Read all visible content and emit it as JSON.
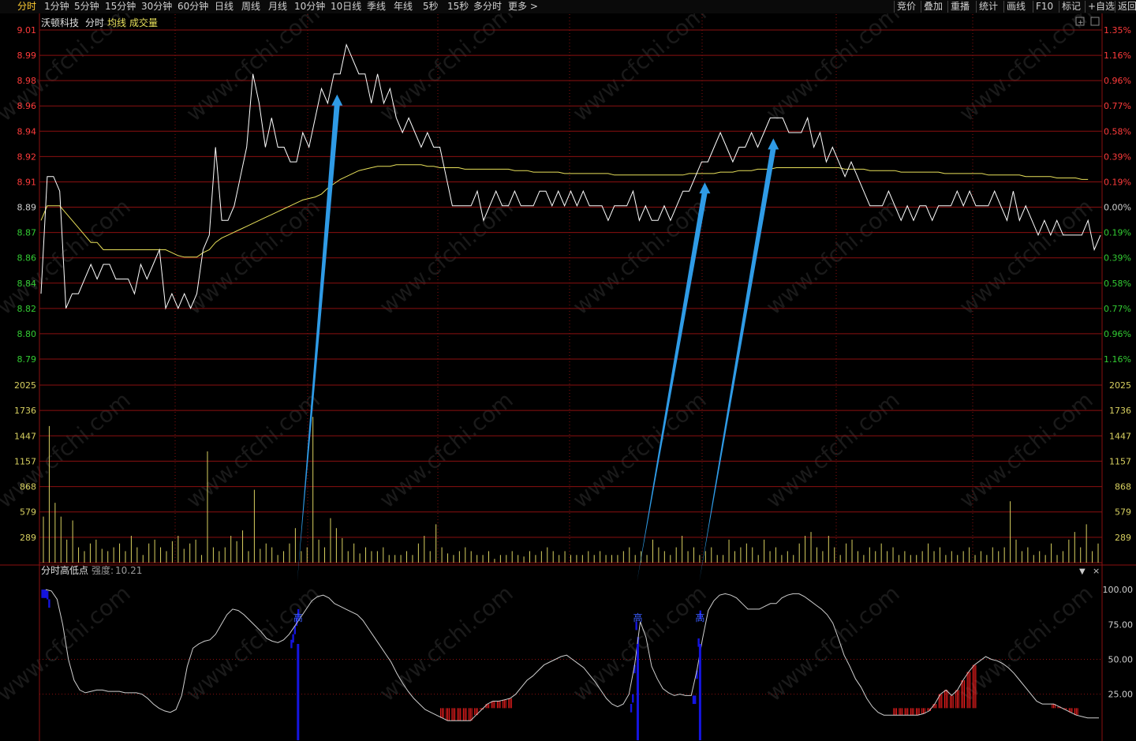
{
  "toolbar": {
    "left": [
      "分时",
      "1分钟",
      "5分钟",
      "15分钟",
      "30分钟",
      "60分钟",
      "日线",
      "周线",
      "月线",
      "10分钟",
      "10日线",
      "季线",
      "年线",
      "5秒",
      "15秒",
      "多分时",
      "更多 >"
    ],
    "active": "分时",
    "right": [
      "竞价",
      "叠加",
      "重播",
      "统计",
      "画线",
      "F10",
      "标记",
      "+自选",
      "返回"
    ]
  },
  "header": {
    "stock_name": "沃顿科技",
    "mode": "分时",
    "avg_label": "均线",
    "vol_label": "成交量"
  },
  "indicator": {
    "name": "分时高低点",
    "strength_label": "强度:",
    "strength_value": "10.21",
    "high_marker": "高"
  },
  "colors": {
    "price_line": "#ffffff",
    "avg_line": "#e8e05a",
    "up_label": "#ff3b3b",
    "down_label": "#33cc33",
    "volume": "#d8d060",
    "grid": "#8a1010",
    "arrow": "#2f9be6",
    "high_bar": "#1515e0",
    "low_bar": "#ff2020"
  },
  "chart_data": [
    {
      "type": "line",
      "title": "沃顿科技 分时",
      "price_ticks_left": [
        "9.01",
        "8.99",
        "8.98",
        "8.96",
        "8.94",
        "8.92",
        "8.91",
        "8.89",
        "8.87",
        "8.86",
        "8.84",
        "8.82",
        "8.80",
        "8.79"
      ],
      "pct_ticks_right": [
        "1.35%",
        "1.16%",
        "0.96%",
        "0.77%",
        "0.58%",
        "0.39%",
        "0.19%",
        "0.00%",
        "0.19%",
        "0.39%",
        "0.58%",
        "0.77%",
        "0.96%",
        "1.16%"
      ],
      "ylim": [
        8.78,
        9.01
      ],
      "prev_close": 8.89,
      "series": [
        {
          "name": "分时",
          "values": [
            8.83,
            8.91,
            8.91,
            8.9,
            8.82,
            8.83,
            8.83,
            8.84,
            8.85,
            8.84,
            8.85,
            8.85,
            8.84,
            8.84,
            8.84,
            8.83,
            8.85,
            8.84,
            8.85,
            8.86,
            8.82,
            8.83,
            8.82,
            8.83,
            8.82,
            8.83,
            8.86,
            8.87,
            8.93,
            8.88,
            8.88,
            8.89,
            8.91,
            8.93,
            8.98,
            8.96,
            8.93,
            8.95,
            8.93,
            8.93,
            8.92,
            8.92,
            8.94,
            8.93,
            8.95,
            8.97,
            8.96,
            8.98,
            8.98,
            9.0,
            8.99,
            8.98,
            8.98,
            8.96,
            8.98,
            8.96,
            8.97,
            8.95,
            8.94,
            8.95,
            8.94,
            8.93,
            8.94,
            8.93,
            8.93,
            8.91,
            8.89,
            8.89,
            8.89,
            8.89,
            8.9,
            8.88,
            8.89,
            8.9,
            8.89,
            8.89,
            8.9,
            8.89,
            8.89,
            8.89,
            8.9,
            8.9,
            8.89,
            8.9,
            8.89,
            8.9,
            8.89,
            8.9,
            8.89,
            8.89,
            8.89,
            8.88,
            8.89,
            8.89,
            8.89,
            8.9,
            8.88,
            8.89,
            8.88,
            8.88,
            8.89,
            8.88,
            8.89,
            8.9,
            8.9,
            8.91,
            8.92,
            8.92,
            8.93,
            8.94,
            8.93,
            8.92,
            8.93,
            8.93,
            8.94,
            8.93,
            8.94,
            8.95,
            8.95,
            8.95,
            8.94,
            8.94,
            8.94,
            8.95,
            8.93,
            8.94,
            8.92,
            8.93,
            8.92,
            8.91,
            8.92,
            8.91,
            8.9,
            8.89,
            8.89,
            8.89,
            8.9,
            8.89,
            8.88,
            8.89,
            8.88,
            8.89,
            8.89,
            8.88,
            8.89,
            8.89,
            8.89,
            8.9,
            8.89,
            8.9,
            8.89,
            8.89,
            8.89,
            8.9,
            8.89,
            8.88,
            8.9,
            8.88,
            8.89,
            8.88,
            8.87,
            8.88,
            8.87,
            8.88,
            8.87,
            8.87,
            8.87,
            8.87,
            8.88,
            8.86,
            8.87
          ]
        },
        {
          "name": "均线",
          "values": [
            8.88,
            8.89,
            8.89,
            8.89,
            8.885,
            8.88,
            8.875,
            8.87,
            8.865,
            8.865,
            8.86,
            8.86,
            8.86,
            8.86,
            8.86,
            8.86,
            8.86,
            8.86,
            8.86,
            8.86,
            8.86,
            8.858,
            8.856,
            8.855,
            8.855,
            8.855,
            8.858,
            8.86,
            8.865,
            8.868,
            8.87,
            8.872,
            8.874,
            8.876,
            8.878,
            8.88,
            8.882,
            8.884,
            8.886,
            8.888,
            8.89,
            8.892,
            8.894,
            8.895,
            8.896,
            8.898,
            8.902,
            8.905,
            8.908,
            8.91,
            8.912,
            8.914,
            8.915,
            8.916,
            8.917,
            8.917,
            8.917,
            8.918,
            8.918,
            8.918,
            8.918,
            8.918,
            8.917,
            8.917,
            8.916,
            8.916,
            8.916,
            8.916,
            8.915,
            8.915,
            8.915,
            8.915,
            8.915,
            8.915,
            8.915,
            8.915,
            8.914,
            8.914,
            8.914,
            8.913,
            8.913,
            8.913,
            8.913,
            8.913,
            8.912,
            8.912,
            8.912,
            8.912,
            8.912,
            8.912,
            8.912,
            8.912,
            8.911,
            8.911,
            8.911,
            8.911,
            8.911,
            8.911,
            8.911,
            8.911,
            8.911,
            8.911,
            8.911,
            8.911,
            8.912,
            8.912,
            8.912,
            8.912,
            8.912,
            8.913,
            8.913,
            8.913,
            8.914,
            8.914,
            8.914,
            8.915,
            8.915,
            8.915,
            8.916,
            8.916,
            8.916,
            8.916,
            8.916,
            8.916,
            8.916,
            8.916,
            8.916,
            8.916,
            8.916,
            8.915,
            8.915,
            8.915,
            8.915,
            8.914,
            8.914,
            8.914,
            8.914,
            8.914,
            8.913,
            8.913,
            8.913,
            8.913,
            8.913,
            8.913,
            8.913,
            8.912,
            8.912,
            8.912,
            8.912,
            8.912,
            8.912,
            8.912,
            8.911,
            8.911,
            8.911,
            8.911,
            8.911,
            8.911,
            8.91,
            8.91,
            8.91,
            8.91,
            8.91,
            8.909,
            8.909,
            8.909,
            8.909,
            8.908,
            8.908
          ]
        }
      ]
    },
    {
      "type": "bar",
      "title": "成交量",
      "ticks": [
        "2025",
        "1736",
        "1447",
        "1157",
        "868",
        "579",
        "289"
      ],
      "ylim": [
        0,
        2314
      ],
      "values": [
        600,
        1780,
        780,
        600,
        300,
        550,
        200,
        150,
        250,
        300,
        180,
        150,
        200,
        250,
        150,
        350,
        200,
        100,
        250,
        300,
        200,
        150,
        280,
        350,
        180,
        250,
        300,
        100,
        1450,
        200,
        150,
        200,
        350,
        280,
        420,
        150,
        950,
        180,
        250,
        200,
        100,
        150,
        250,
        450,
        150,
        200,
        1900,
        300,
        200,
        580,
        450,
        320,
        150,
        250,
        120,
        200,
        150,
        150,
        200,
        100,
        100,
        100,
        150,
        100,
        250,
        350,
        150,
        500,
        200,
        120,
        100,
        150,
        200,
        150,
        100,
        100,
        150,
        50,
        100,
        100,
        150,
        100,
        80,
        150,
        100,
        150,
        200,
        150,
        100,
        150,
        100,
        100,
        100,
        150,
        100,
        150,
        100,
        100,
        100,
        150,
        200,
        100,
        150,
        100,
        300,
        200,
        150,
        100,
        200,
        350,
        150,
        200,
        100,
        150,
        200,
        100,
        100,
        300,
        150,
        200,
        250,
        200,
        100,
        300,
        150,
        200,
        100,
        150,
        100,
        250,
        350,
        400,
        200,
        150,
        350,
        200,
        100,
        250,
        300,
        150,
        100,
        200,
        150,
        250,
        150,
        200,
        100,
        150,
        100,
        100,
        150,
        250,
        150,
        200,
        100,
        150,
        100,
        150,
        200,
        100,
        150,
        100,
        200,
        150,
        200,
        800,
        300,
        150,
        200,
        100,
        150,
        100,
        250,
        100,
        150,
        300,
        400,
        200,
        500,
        150,
        250
      ]
    },
    {
      "type": "line",
      "title": "分时高低点 强度:10.21",
      "ticks": [
        "100.00",
        "75.00",
        "50.00",
        "25.00"
      ],
      "ylim": [
        -8,
        108
      ],
      "series": [
        {
          "name": "分时高低点",
          "values": [
            100,
            99,
            93,
            75,
            50,
            35,
            28,
            26,
            27,
            28,
            28,
            27,
            27,
            27,
            26,
            26,
            26,
            25,
            22,
            18,
            15,
            13,
            12,
            14,
            24,
            45,
            58,
            61,
            63,
            64,
            68,
            75,
            82,
            86,
            85,
            82,
            78,
            74,
            70,
            65,
            63,
            62,
            64,
            68,
            74,
            80,
            86,
            92,
            95,
            96,
            94,
            90,
            88,
            86,
            84,
            82,
            78,
            72,
            66,
            60,
            54,
            48,
            40,
            33,
            27,
            22,
            18,
            14,
            12,
            10,
            8,
            6,
            6,
            6,
            6,
            6,
            10,
            14,
            18,
            20,
            20,
            21,
            22,
            25,
            30,
            35,
            38,
            42,
            46,
            48,
            50,
            52,
            53,
            50,
            47,
            44,
            39,
            34,
            28,
            22,
            18,
            16,
            18,
            25,
            46,
            77,
            66,
            45,
            36,
            29,
            26,
            24,
            25,
            24,
            24,
            42,
            65,
            85,
            92,
            96,
            97,
            96,
            94,
            90,
            86,
            86,
            86,
            88,
            90,
            90,
            94,
            96,
            97,
            97,
            95,
            92,
            89,
            86,
            82,
            76,
            65,
            53,
            45,
            36,
            30,
            22,
            16,
            12,
            10,
            10,
            10,
            10,
            10,
            10,
            10,
            11,
            13,
            18,
            25,
            28,
            24,
            28,
            35,
            41,
            46,
            49,
            52,
            50,
            49,
            47,
            44,
            40,
            35,
            30,
            25,
            20,
            18,
            18,
            18,
            16,
            14,
            12,
            10,
            9,
            8,
            8,
            8
          ]
        }
      ],
      "high_points": [
        44,
        104,
        115
      ],
      "high_at_open": 0,
      "low_zones": [
        [
          70,
          82
        ],
        [
          150,
          164
        ],
        [
          178,
          182
        ]
      ]
    }
  ]
}
